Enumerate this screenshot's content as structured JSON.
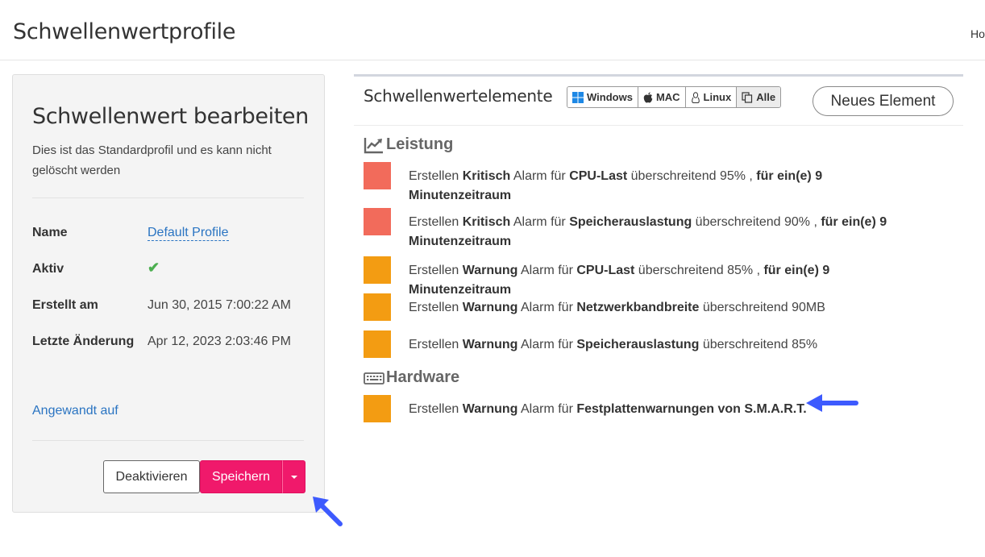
{
  "header": {
    "title": "Schwellenwertprofile",
    "home_link": "Ho"
  },
  "edit_panel": {
    "title": "Schwellenwert bearbeiten",
    "description": "Dies ist das Standardprofil und es kann nicht gelöscht werden",
    "rows": [
      {
        "label": "Name",
        "value": "Default Profile"
      },
      {
        "label": "Aktiv",
        "value": "✔"
      },
      {
        "label": "Erstellt am",
        "value": "Jun 30, 2015 7:00:22 AM"
      },
      {
        "label": "Letzte Änderung",
        "value": "Apr 12, 2023 2:03:46 PM"
      }
    ],
    "applied_link": "Angewandt auf",
    "deactivate_label": "Deaktivieren",
    "save_label": "Speichern"
  },
  "elements_panel": {
    "title": "Schwellenwertelemente",
    "os_filters": [
      "Windows",
      "MAC",
      "Linux",
      "Alle"
    ],
    "new_element_label": "Neues Element",
    "sections": [
      {
        "title": "Leistung",
        "items": [
          {
            "severity": "Kritisch",
            "color": "#f26b5b",
            "pre": "Erstellen ",
            "sev_word": "Kritisch",
            "mid": " Alarm für ",
            "metric": "CPU-Last",
            "cond": " überschreitend 95% , ",
            "period": "für ein(e) 9 Minutenzeitraum"
          },
          {
            "severity": "Kritisch",
            "color": "#f26b5b",
            "pre": "Erstellen ",
            "sev_word": "Kritisch",
            "mid": " Alarm für ",
            "metric": "Speicherauslastung",
            "cond": " überschreitend 90% , ",
            "period": "für ein(e) 9 Minutenzeitraum"
          },
          {
            "severity": "Warnung",
            "color": "#f39c12",
            "pre": "Erstellen ",
            "sev_word": "Warnung",
            "mid": " Alarm für ",
            "metric": "CPU-Last",
            "cond": " überschreitend 85% , ",
            "period": "für ein(e) 9 Minutenzeitraum"
          },
          {
            "severity": "Warnung",
            "color": "#f39c12",
            "pre": "Erstellen ",
            "sev_word": "Warnung",
            "mid": " Alarm für ",
            "metric": "Netzwerkbandbreite",
            "cond": " überschreitend 90MB",
            "period": ""
          },
          {
            "severity": "Warnung",
            "color": "#f39c12",
            "pre": "Erstellen ",
            "sev_word": "Warnung",
            "mid": " Alarm für ",
            "metric": "Speicherauslastung",
            "cond": " überschreitend 85%",
            "period": ""
          }
        ]
      },
      {
        "title": "Hardware",
        "items": [
          {
            "severity": "Warnung",
            "color": "#f39c12",
            "pre": "Erstellen ",
            "sev_word": "Warnung",
            "mid": " Alarm für ",
            "metric": "Festplattenwarnungen von S.M.A.R.T.",
            "cond": "",
            "period": ""
          }
        ]
      }
    ]
  },
  "colors": {
    "accent": "#f0196b",
    "link": "#2a74c2",
    "critical": "#f26b5b",
    "warning": "#f39c12",
    "annotation_arrow": "#3d5afe"
  }
}
